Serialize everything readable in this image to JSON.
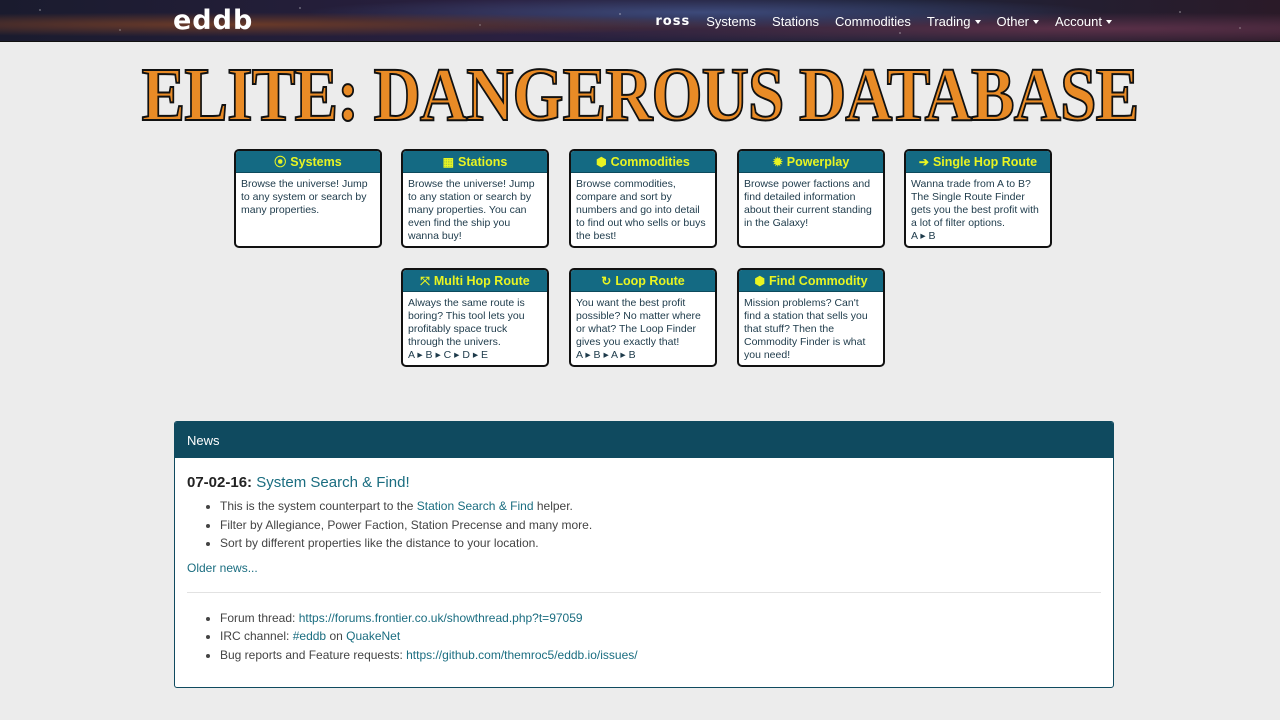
{
  "navbar": {
    "logo": "eddb",
    "user": "ross",
    "items": [
      {
        "label": "Systems",
        "dropdown": false
      },
      {
        "label": "Stations",
        "dropdown": false
      },
      {
        "label": "Commodities",
        "dropdown": false
      },
      {
        "label": "Trading",
        "dropdown": true
      },
      {
        "label": "Other",
        "dropdown": true
      },
      {
        "label": "Account",
        "dropdown": true
      }
    ]
  },
  "banner": {
    "title": "ELITE: DANGEROUS DATABASE"
  },
  "tiles": [
    {
      "icon": "target-icon",
      "glyph": "⦿",
      "title": "Systems",
      "text": "Browse the universe! Jump to any system or search by many properties."
    },
    {
      "icon": "building-icon",
      "glyph": "▦",
      "title": "Stations",
      "text": "Browse the universe! Jump to any station or search by many properties. You can even find the ship you wanna buy!"
    },
    {
      "icon": "cube-icon",
      "glyph": "⬢",
      "title": "Commodities",
      "text": "Browse commodities, compare and sort by numbers and go into detail to find out who sells or buys the best!"
    },
    {
      "icon": "sun-icon",
      "glyph": "✹",
      "title": "Powerplay",
      "text": "Browse power factions and find detailed information about their current standing in the Galaxy!"
    },
    {
      "icon": "arrow-right-icon",
      "glyph": "➔",
      "title": "Single Hop Route",
      "text": "Wanna trade from A to B? The Single Route Finder gets you the best profit with a lot of filter options.",
      "route": "A ▸ B"
    },
    {
      "icon": "expand-arrows-icon",
      "glyph": "⤧",
      "title": "Multi Hop Route",
      "text": "Always the same route is boring? This tool lets you profitably space truck through the univers.",
      "route": "A ▸ B ▸ C ▸ D ▸ E"
    },
    {
      "icon": "refresh-icon",
      "glyph": "↻",
      "title": "Loop Route",
      "text": "You want the best profit possible? No matter where or what? The Loop Finder gives you exactly that!",
      "route": "A ▸ B ▸ A ▸ B"
    },
    {
      "icon": "cube-icon",
      "glyph": "⬢",
      "title": "Find Commodity",
      "text": "Mission problems? Can't find a station that sells you that stuff? Then the Commodity Finder is what you need!"
    }
  ],
  "news": {
    "header": "News",
    "date": "07-02-16:",
    "headline": "System Search & Find!",
    "bullets": {
      "b1_pre": "This is the system counterpart to the",
      "b1_link": "Station Search & Find",
      "b1_post": "helper.",
      "b2": "Filter by Allegiance, Power Faction, Station Precense and many more.",
      "b3": "Sort by different properties like the distance to your location."
    },
    "older": "Older news...",
    "links": {
      "forum_label": "Forum thread:",
      "forum_url": "https://forums.frontier.co.uk/showthread.php?t=97059",
      "irc_label": "IRC channel:",
      "irc_channel": "#eddb",
      "irc_on": "on",
      "irc_network": "QuakeNet",
      "bug_label": "Bug reports and Feature requests:",
      "bug_url": "https://github.com/themroc5/eddb.io/issues/"
    }
  }
}
